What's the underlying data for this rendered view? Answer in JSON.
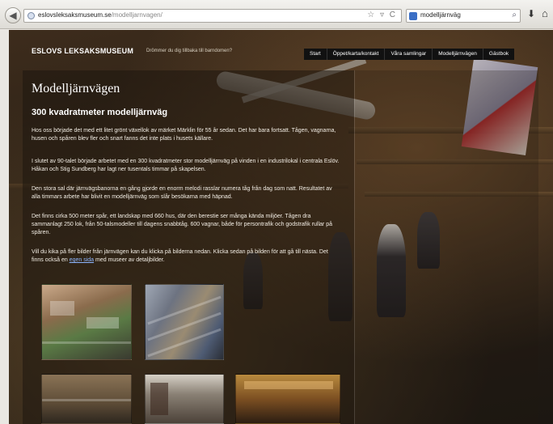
{
  "browser": {
    "url_host": "eslovsleksaksmuseum.se",
    "url_path": "/modelljarnvagen/",
    "search_text": "modelljärnväg"
  },
  "site": {
    "title": "ESLOVS LEKSAKSMUSEUM",
    "tagline": "Drömmer du dig tillbaka till barndomen?"
  },
  "nav": {
    "items": [
      "Start",
      "Öppet/karta/kontakt",
      "Våra samlingar",
      "Modelljärnvägen",
      "Gästbok"
    ]
  },
  "content": {
    "heading": "Modelljärnvägen",
    "subheading": "300 kvadratmeter modelljärnväg",
    "paragraphs": [
      "Hos oss började det med ett litet grönt växellok av märket Märklin för 55 år sedan. Det har bara fortsatt. Tågen, vagnarna, husen och spåren blev fler och snart fanns det inte plats i husets källare.",
      "I slutet av 90-talet började arbetet med en 300 kvadratmeter stor modelljärnväg på vinden i en industrilokal i centrala Eslöv. Håkan och Stig Sundberg har lagt ner tusentals timmar på skapelsen.",
      "Den stora sal där järnvägsbanorna en gång gjorde en enorm melodi rasslar numera tåg från dag som natt. Resultatet av alla timmars arbete har blivit en modelljärnväg som slår besökarna med häpnad.",
      "Det finns cirka 500 meter spår, ett landskap med 660 hus, där den berestie ser många kända miljöer. Tågen dra sammanlagt 250 lok, från 50-talsmodeller till dagens snabbtåg. 600 vagnar, både för persontrafik och godstrafik rullar på spåren.",
      "Vill du kika på fler bilder från järnvägen kan du klicka på bilderna nedan. Klicka sedan på bilden för att gå till nästa. Det finns också en"
    ],
    "link_text": "egen sida",
    "last_suffix": "med museer av detaljbilder."
  }
}
